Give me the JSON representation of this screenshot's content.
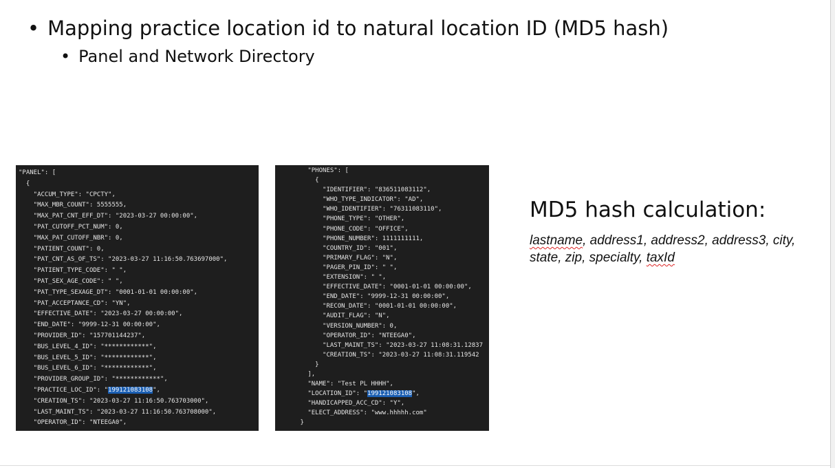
{
  "bullets": {
    "main": "Mapping practice location id to natural location ID (MD5 hash)",
    "sub": "Panel and Network Directory"
  },
  "bullet_glyph": "•",
  "md5": {
    "title": "MD5 hash calculation:",
    "fields": [
      "lastname",
      "address1",
      "address2",
      "address3",
      "city",
      "state",
      "zip",
      "specialty",
      "taxId"
    ],
    "misspelled": [
      "lastname",
      "taxId"
    ]
  },
  "panel_json": [
    {
      "t": "\"PANEL\": ["
    },
    {
      "t": "  {"
    },
    {
      "t": "    \"ACCUM_TYPE\": \"CPCTY\","
    },
    {
      "t": "    \"MAX_MBR_COUNT\": 5555555,"
    },
    {
      "t": "    \"MAX_PAT_CNT_EFF_DT\": \"2023-03-27 00:00:00\","
    },
    {
      "t": "    \"PAT_CUTOFF_PCT_NUM\": 0,"
    },
    {
      "t": "    \"MAX_PAT_CUTOFF_NBR\": 0,"
    },
    {
      "t": "    \"PATIENT_COUNT\": 0,"
    },
    {
      "t": "    \"PAT_CNT_AS_OF_TS\": \"2023-03-27 11:16:50.763697000\","
    },
    {
      "t": "    \"PATIENT_TYPE_CODE\": \" \","
    },
    {
      "t": "    \"PAT_SEX_AGE_CODE\": \" \","
    },
    {
      "t": "    \"PAT_TYPE_SEXAGE_DT\": \"0001-01-01 00:00:00\","
    },
    {
      "t": "    \"PAT_ACCEPTANCE_CD\": \"YN\","
    },
    {
      "t": "    \"EFFECTIVE_DATE\": \"2023-03-27 00:00:00\","
    },
    {
      "t": "    \"END_DATE\": \"9999-12-31 00:00:00\","
    },
    {
      "t": "    \"PROVIDER_ID\": \"157701144237\","
    },
    {
      "t": "    \"BUS_LEVEL_4_ID\": \"************\","
    },
    {
      "t": "    \"BUS_LEVEL_5_ID\": \"************\","
    },
    {
      "t": "    \"BUS_LEVEL_6_ID\": \"************\","
    },
    {
      "t": "    \"PROVIDER_GROUP_ID\": \"************\","
    },
    {
      "t": "    \"PRACTICE_LOC_ID\": \"",
      "hl": "199121083108",
      "post": "\","
    },
    {
      "t": "    \"CREATION_TS\": \"2023-03-27 11:16:50.763703000\","
    },
    {
      "t": "    \"LAST_MAINT_TS\": \"2023-03-27 11:16:50.763708000\","
    },
    {
      "t": "    \"OPERATOR_ID\": \"NTEEGA0\","
    }
  ],
  "phones_json": [
    {
      "t": "        \"PHONES\": ["
    },
    {
      "t": "          {"
    },
    {
      "t": "            \"IDENTIFIER\": \"836511083112\","
    },
    {
      "t": "            \"WHO_TYPE_INDICATOR\": \"AD\","
    },
    {
      "t": "            \"WHO_IDENTIFIER\": \"76311083110\","
    },
    {
      "t": "            \"PHONE_TYPE\": \"OTHER\","
    },
    {
      "t": "            \"PHONE_CODE\": \"OFFICE\","
    },
    {
      "t": "            \"PHONE_NUMBER\": 1111111111,"
    },
    {
      "t": "            \"COUNTRY_ID\": \"001\","
    },
    {
      "t": "            \"PRIMARY_FLAG\": \"N\","
    },
    {
      "t": "            \"PAGER_PIN_ID\": \" \","
    },
    {
      "t": "            \"EXTENSION\": \" \","
    },
    {
      "t": "            \"EFFECTIVE_DATE\": \"0001-01-01 00:00:00\","
    },
    {
      "t": "            \"END_DATE\": \"9999-12-31 00:00:00\","
    },
    {
      "t": "            \"RECON_DATE\": \"0001-01-01 00:00:00\","
    },
    {
      "t": "            \"AUDIT_FLAG\": \"N\","
    },
    {
      "t": "            \"VERSION_NUMBER\": 0,"
    },
    {
      "t": "            \"OPERATOR_ID\": \"NTEEGA0\","
    },
    {
      "t": "            \"LAST_MAINT_TS\": \"2023-03-27 11:08:31.12837"
    },
    {
      "t": "            \"CREATION_TS\": \"2023-03-27 11:08:31.119542"
    },
    {
      "t": "          }"
    },
    {
      "t": "        ],"
    },
    {
      "t": "        \"NAME\": \"Test PL HHHH\","
    },
    {
      "t": "        \"LOCATION_ID\": \"",
      "hl": "199121083108",
      "post": "\","
    },
    {
      "t": "        \"HANDICAPPED_ACC_CD\": \"Y\","
    },
    {
      "t": "        \"ELECT_ADDRESS\": \"www.hhhhh.com\""
    },
    {
      "t": "      }"
    }
  ]
}
